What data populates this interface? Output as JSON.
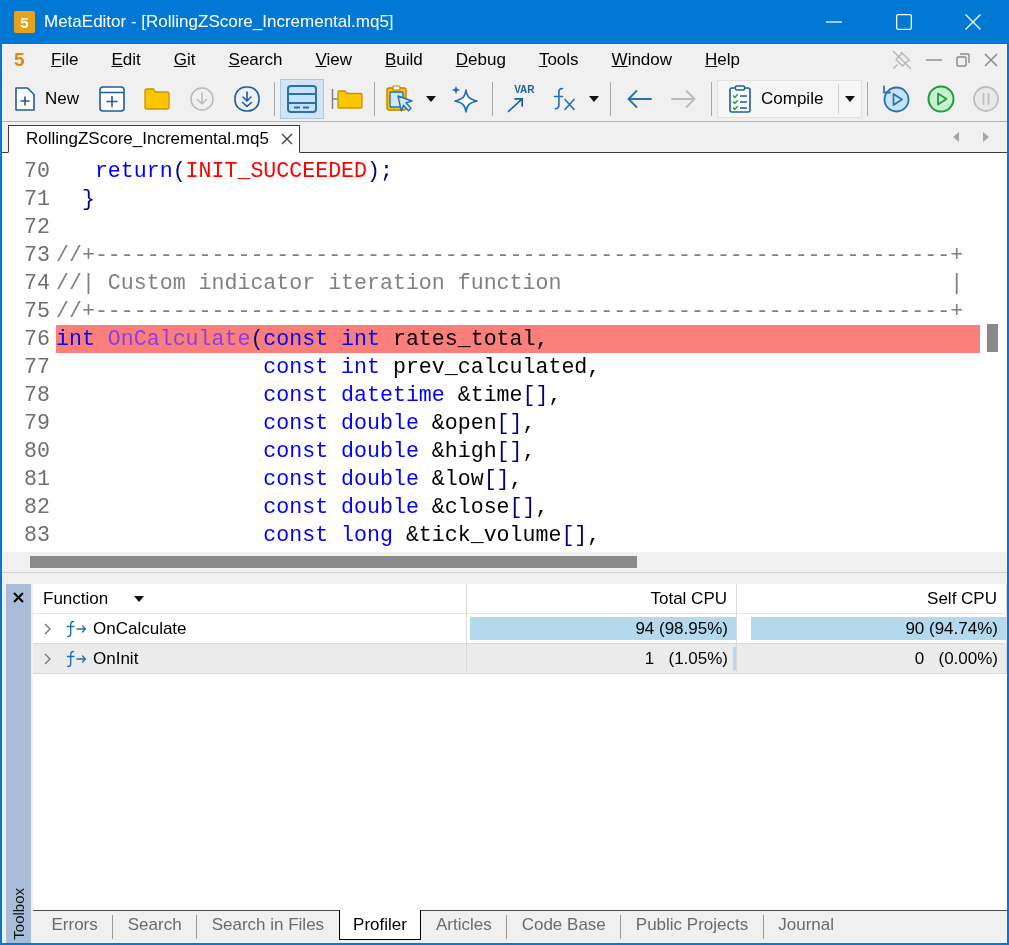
{
  "window": {
    "icon_label": "5",
    "title": "MetaEditor - [RollingZScore_Incremental.mq5]"
  },
  "menu": {
    "logo": "5",
    "items": [
      "File",
      "Edit",
      "Git",
      "Search",
      "View",
      "Build",
      "Debug",
      "Tools",
      "Window",
      "Help"
    ]
  },
  "toolbar": {
    "tools": [
      {
        "kind": "button",
        "label": "New",
        "disabled": false,
        "pressed": false
      },
      {
        "kind": "button",
        "disabled": false,
        "pressed": false
      },
      {
        "kind": "button",
        "disabled": false,
        "pressed": false
      },
      {
        "kind": "button",
        "disabled": true,
        "pressed": false
      },
      {
        "kind": "button",
        "disabled": false,
        "pressed": false
      },
      {
        "kind": "separator"
      },
      {
        "kind": "button",
        "disabled": false,
        "pressed": true
      },
      {
        "kind": "button",
        "disabled": false,
        "pressed": false
      },
      {
        "kind": "separator"
      },
      {
        "kind": "split",
        "disabled": false,
        "pressed": false
      },
      {
        "kind": "button",
        "disabled": false,
        "pressed": false
      },
      {
        "kind": "separator"
      },
      {
        "kind": "button",
        "icon_text": "VAR",
        "disabled": false,
        "pressed": false
      },
      {
        "kind": "split",
        "disabled": false,
        "pressed": false
      },
      {
        "kind": "separator"
      },
      {
        "kind": "button",
        "disabled": false,
        "pressed": false
      },
      {
        "kind": "button",
        "disabled": true,
        "pressed": false
      },
      {
        "kind": "separator"
      },
      {
        "kind": "split",
        "label": "Compile",
        "disabled": false,
        "pressed": false
      },
      {
        "kind": "separator"
      },
      {
        "kind": "button",
        "disabled": false,
        "pressed": false
      },
      {
        "kind": "button",
        "disabled": false,
        "pressed": false
      },
      {
        "kind": "button",
        "disabled": true,
        "pressed": false
      }
    ]
  },
  "editor_tabs": [
    {
      "label": "RollingZScore_Incremental.mq5",
      "selected": true
    }
  ],
  "editor": {
    "lines": [
      {
        "number": "70",
        "highlighted": false,
        "tokens": [
          {
            "text": "   return",
            "kind": "keyword"
          },
          {
            "text": "(",
            "kind": "bracket"
          },
          {
            "text": "INIT_SUCCEEDED",
            "kind": "constant"
          },
          {
            "text": ");",
            "kind": "bracket"
          }
        ]
      },
      {
        "number": "71",
        "highlighted": false,
        "tokens": [
          {
            "text": "  }",
            "kind": "bracket"
          }
        ]
      },
      {
        "number": "72",
        "highlighted": false
      },
      {
        "number": "73",
        "highlighted": false,
        "tokens": [
          {
            "text": "//+------------------------------------------------------------------+",
            "kind": "comment"
          }
        ]
      },
      {
        "number": "74",
        "highlighted": false,
        "tokens": [
          {
            "text": "//| Custom indicator iteration function                              |",
            "kind": "comment"
          }
        ]
      },
      {
        "number": "75",
        "highlighted": false,
        "tokens": [
          {
            "text": "//+------------------------------------------------------------------+",
            "kind": "comment"
          }
        ]
      },
      {
        "number": "76",
        "highlighted": true,
        "tokens": [
          {
            "text": "int ",
            "kind": "keyword"
          },
          {
            "text": "OnCalculate",
            "kind": "function"
          },
          {
            "text": "(",
            "kind": "bracket"
          },
          {
            "text": "const int ",
            "kind": "keyword"
          },
          {
            "text": "rates_total,",
            "kind": "plain"
          }
        ]
      },
      {
        "number": "77",
        "highlighted": false,
        "tokens": [
          {
            "text": "                const int ",
            "kind": "keyword"
          },
          {
            "text": "prev_calculated,",
            "kind": "plain"
          }
        ]
      },
      {
        "number": "78",
        "highlighted": false,
        "tokens": [
          {
            "text": "                const datetime ",
            "kind": "keyword"
          },
          {
            "text": "&time",
            "kind": "plain"
          },
          {
            "text": "[]",
            "kind": "bracket"
          },
          {
            "text": ",",
            "kind": "plain"
          }
        ]
      },
      {
        "number": "79",
        "highlighted": false,
        "tokens": [
          {
            "text": "                const double ",
            "kind": "keyword"
          },
          {
            "text": "&open",
            "kind": "plain"
          },
          {
            "text": "[]",
            "kind": "bracket"
          },
          {
            "text": ",",
            "kind": "plain"
          }
        ]
      },
      {
        "number": "80",
        "highlighted": false,
        "tokens": [
          {
            "text": "                const double ",
            "kind": "keyword"
          },
          {
            "text": "&high",
            "kind": "plain"
          },
          {
            "text": "[]",
            "kind": "bracket"
          },
          {
            "text": ",",
            "kind": "plain"
          }
        ]
      },
      {
        "number": "81",
        "highlighted": false,
        "tokens": [
          {
            "text": "                const double ",
            "kind": "keyword"
          },
          {
            "text": "&low",
            "kind": "plain"
          },
          {
            "text": "[]",
            "kind": "bracket"
          },
          {
            "text": ",",
            "kind": "plain"
          }
        ]
      },
      {
        "number": "82",
        "highlighted": false,
        "tokens": [
          {
            "text": "                const double ",
            "kind": "keyword"
          },
          {
            "text": "&close",
            "kind": "plain"
          },
          {
            "text": "[]",
            "kind": "bracket"
          },
          {
            "text": ",",
            "kind": "plain"
          }
        ]
      },
      {
        "number": "83",
        "highlighted": false,
        "tokens": [
          {
            "text": "                const long ",
            "kind": "keyword"
          },
          {
            "text": "&tick_volume",
            "kind": "plain"
          },
          {
            "text": "[]",
            "kind": "bracket"
          },
          {
            "text": ",",
            "kind": "plain"
          }
        ]
      }
    ]
  },
  "toolbox": {
    "title": "Toolbox",
    "profiler": {
      "columns": [
        "Function",
        "Total CPU",
        "Self CPU"
      ],
      "rows": [
        {
          "name": "OnCalculate",
          "expanded": false,
          "selected": false,
          "total": {
            "text": "94 (98.95%)",
            "level": 0.9895
          },
          "self": {
            "text": "90 (94.74%)",
            "level": 0.9474
          }
        },
        {
          "name": "OnInit",
          "expanded": false,
          "selected": true,
          "total": {
            "text": "1   (1.05%)",
            "level": 0.0105
          },
          "self": {
            "text": "0   (0.00%)"
          }
        }
      ]
    },
    "tabs": [
      {
        "label": "Errors",
        "selected": false
      },
      {
        "label": "Search",
        "selected": false
      },
      {
        "label": "Search in Files",
        "selected": false
      },
      {
        "label": "Profiler",
        "selected": true
      },
      {
        "label": "Articles",
        "selected": false
      },
      {
        "label": "Code Base",
        "selected": false
      },
      {
        "label": "Public Projects",
        "selected": false
      },
      {
        "label": "Journal",
        "selected": false
      }
    ]
  }
}
